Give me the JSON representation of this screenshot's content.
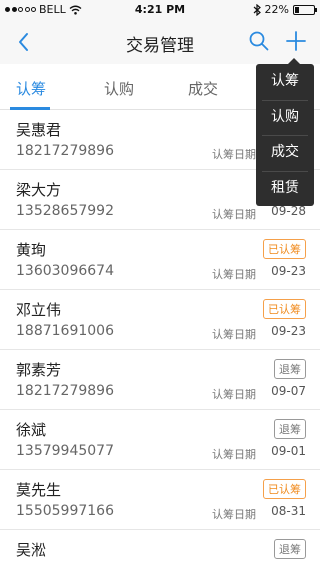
{
  "status_bar": {
    "carrier": "BELL",
    "time": "4:21 PM",
    "battery": "22%",
    "battery_level": 0.22,
    "signal_dots": 2
  },
  "nav": {
    "title": "交易管理",
    "back_icon": "chevron-left-icon",
    "search_icon": "search-icon",
    "add_icon": "plus-icon",
    "accent": "#2a8ae0"
  },
  "tabs": [
    {
      "label": "认筹",
      "active": true
    },
    {
      "label": "认购",
      "active": false
    },
    {
      "label": "成交",
      "active": false
    }
  ],
  "dropdown_menu": {
    "items": [
      "认筹",
      "认购",
      "成交",
      "租赁"
    ]
  },
  "records": [
    {
      "name": "吴惠君",
      "phone": "18217279896",
      "date_label": "认筹日期",
      "date": "",
      "badge": ""
    },
    {
      "name": "梁大方",
      "phone": "13528657992",
      "date_label": "认筹日期",
      "date": "09-28",
      "badge": ""
    },
    {
      "name": "黄珣",
      "phone": "13603096674",
      "date_label": "认筹日期",
      "date": "09-23",
      "badge": "已认筹",
      "badge_color": "#f08a1c"
    },
    {
      "name": "邓立伟",
      "phone": "18871691006",
      "date_label": "认筹日期",
      "date": "09-23",
      "badge": "已认筹",
      "badge_color": "#f08a1c"
    },
    {
      "name": "郭素芳",
      "phone": "18217279896",
      "date_label": "认筹日期",
      "date": "09-07",
      "badge": "退筹",
      "badge_color": "#777777"
    },
    {
      "name": "徐斌",
      "phone": "13579945077",
      "date_label": "认筹日期",
      "date": "09-01",
      "badge": "退筹",
      "badge_color": "#777777"
    },
    {
      "name": "莫先生",
      "phone": "15505997166",
      "date_label": "认筹日期",
      "date": "08-31",
      "badge": "已认筹",
      "badge_color": "#f08a1c"
    },
    {
      "name": "吴淞",
      "phone": "",
      "date_label": "",
      "date": "",
      "badge": "退筹",
      "badge_color": "#777777"
    }
  ]
}
